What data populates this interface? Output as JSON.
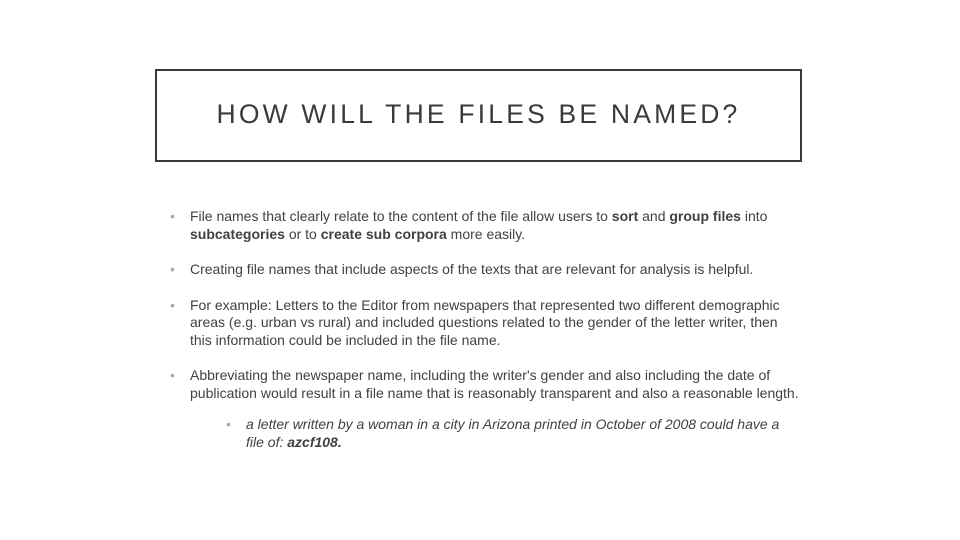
{
  "title": "HOW WILL THE FILES BE NAMED?",
  "bullets": {
    "b1": {
      "t1": "File names that clearly relate to the content of the file allow users to ",
      "sort": "sort",
      "t2": " and ",
      "group": "group files",
      "t3": " into ",
      "sub": "subcategories",
      "t4": " or to ",
      "create": "create sub corpora",
      "t5": " more easily."
    },
    "b2": " Creating file names that include aspects of the texts that are relevant for analysis is helpful.",
    "b3": "For example: Letters to the Editor from newspapers that represented two different demographic areas (e.g. urban vs rural) and included questions related to the gender of the letter writer, then this information could be included in the file name.",
    "b4": "Abbreviating the newspaper name, including the writer's gender and also including the date of publication would result in a file name that is reasonably transparent and also a reasonable length.",
    "sub1": {
      "t1": "a letter written by a woman in a city in Arizona printed in October of 2008 could have a file of: ",
      "code": "azcf108."
    }
  }
}
